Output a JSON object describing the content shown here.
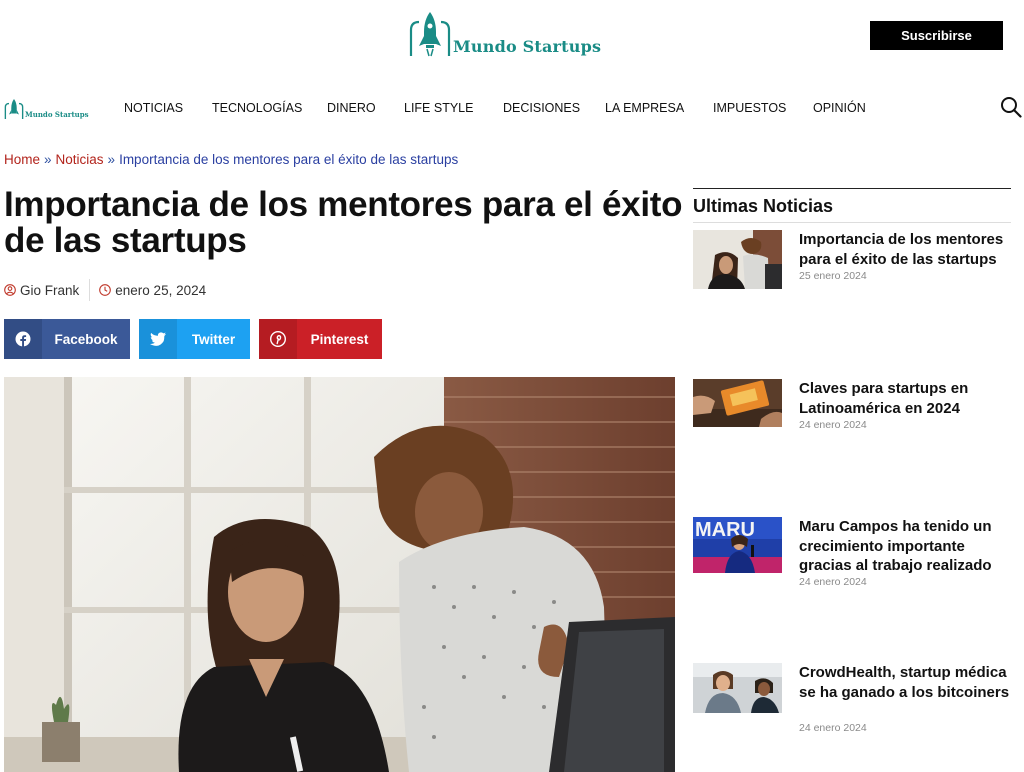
{
  "brand": {
    "name": "Mundo Startups",
    "color": "#1a8c86"
  },
  "header": {
    "subscribe_label": "Suscribirse"
  },
  "nav": {
    "items": [
      {
        "label": "NOTICIAS"
      },
      {
        "label": "TECNOLOGÍAS"
      },
      {
        "label": "DINERO"
      },
      {
        "label": "LIFE STYLE"
      },
      {
        "label": "DECISIONES"
      },
      {
        "label": "LA EMPRESA"
      },
      {
        "label": "IMPUESTOS"
      },
      {
        "label": "OPINIÓN"
      }
    ],
    "search_icon": "search-icon"
  },
  "breadcrumb": {
    "home": "Home",
    "separator": "»",
    "category": "Noticias",
    "current": "Importancia de los mentores para el éxito de las startups"
  },
  "article": {
    "title": "Importancia de los mentores para el éxito de las startups",
    "author": "Gio Frank",
    "date": "enero 25, 2024",
    "author_icon": "user-circle-icon",
    "date_icon": "clock-icon"
  },
  "share": {
    "facebook": "Facebook",
    "twitter": "Twitter",
    "pinterest": "Pinterest",
    "colors": {
      "facebook": "#3b5998",
      "twitter": "#1da1f2",
      "pinterest": "#cb2027"
    }
  },
  "sidebar": {
    "title": "Ultimas Noticias",
    "items": [
      {
        "title": "Importancia de los mentores para el éxito de las startups",
        "date": "25 enero 2024"
      },
      {
        "title": "Claves para startups en Latinoamérica en 2024",
        "date": "24 enero 2024"
      },
      {
        "title": "Maru Campos ha tenido un crecimiento importante gracias al trabajo realizado",
        "date": "24 enero 2024"
      },
      {
        "title": "CrowdHealth, startup médica se ha ganado a los bitcoiners",
        "date": "24 enero 2024"
      }
    ]
  },
  "colors": {
    "link_red": "#b3241c",
    "link_blue": "#2a3fa1",
    "accent_teal": "#1a8c86"
  }
}
